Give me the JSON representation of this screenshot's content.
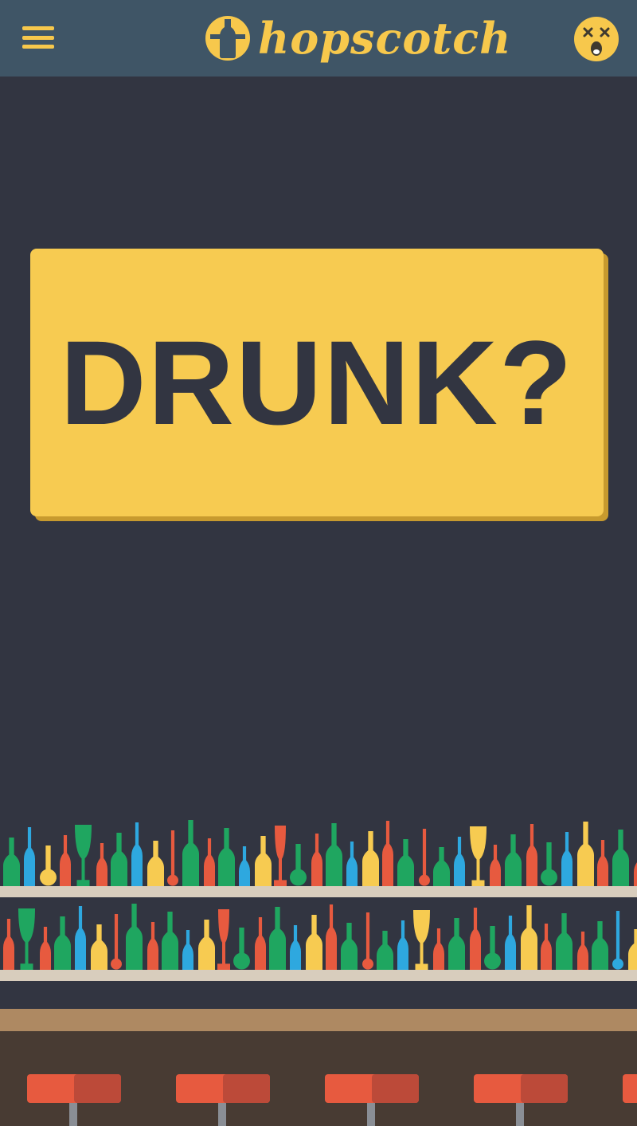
{
  "header": {
    "brand": "hopscotch",
    "menu_icon": "hamburger-menu-icon",
    "logo_icon": "bottle-logo-icon",
    "avatar_icon": "dizzy-face-icon"
  },
  "main": {
    "drunk_label": "DRUNK?"
  },
  "colors": {
    "header_bg": "#3f5566",
    "page_bg": "#323541",
    "accent": "#f7cb51",
    "bottle_red": "#e75a3f",
    "bottle_green": "#1fa660",
    "bottle_blue": "#2ea8df",
    "bottle_yellow": "#f7cb51",
    "shelf": "#d8cdbd",
    "counter": "#ae8962",
    "counter_front": "#483b33",
    "stool_seat": "#e75a3f"
  }
}
